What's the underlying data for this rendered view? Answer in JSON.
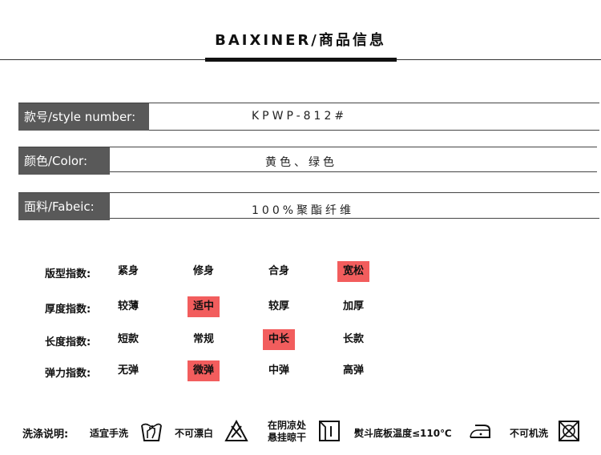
{
  "header": {
    "title": "BAIXINER/商品信息"
  },
  "info": {
    "style_label": "款号/style number:",
    "style_value": "KPWP-812#",
    "color_label": "颜色/Color:",
    "color_value": "黄色、绿色",
    "fabric_label": "面料/Fabeic:",
    "fabric_value": "100%聚酯纤维"
  },
  "index": [
    {
      "label": "版型指数:",
      "options": [
        "紧身",
        "修身",
        "合身",
        "宽松"
      ],
      "selected": 3
    },
    {
      "label": "厚度指数:",
      "options": [
        "较薄",
        "适中",
        "较厚",
        "加厚"
      ],
      "selected": 1
    },
    {
      "label": "长度指数:",
      "options": [
        "短款",
        "常规",
        "中长",
        "长款"
      ],
      "selected": 2
    },
    {
      "label": "弹力指数:",
      "options": [
        "无弹",
        "微弹",
        "中弹",
        "高弹"
      ],
      "selected": 1
    }
  ],
  "highlight_color": "#f25d5d",
  "care": {
    "title": "洗涤说明:",
    "hand_wash": "适宜手洗",
    "no_bleach": "不可漂白",
    "shade_dry_line1": "在阴凉处",
    "shade_dry_line2": "悬挂晾干",
    "iron": "熨斗底板温度≤110℃",
    "no_machine_wash": "不可机洗"
  }
}
